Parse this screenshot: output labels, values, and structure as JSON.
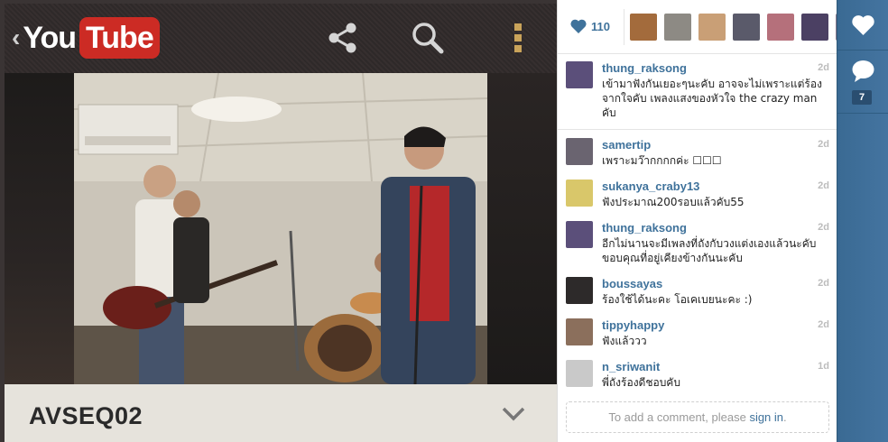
{
  "video_screen": {
    "logo": {
      "back_glyph": "‹",
      "you": "You",
      "tube": "Tube"
    },
    "icons": [
      "share-icon",
      "search-icon",
      "more-vertical-icon"
    ],
    "title": "AVSEQ02",
    "colors": {
      "logo_red": "#cc2b24",
      "title_bar": "#e6e3dc"
    }
  },
  "likes": {
    "count": "110",
    "likers": [
      {
        "color": "#a36b3c"
      },
      {
        "color": "#8d8a84"
      },
      {
        "color": "#c99f76"
      },
      {
        "color": "#5a5a6a"
      },
      {
        "color": "#b5707b"
      },
      {
        "color": "#4b4063"
      },
      {
        "color": "#8b7d91"
      }
    ]
  },
  "caption": {
    "user": "thung_raksong",
    "time": "2d",
    "text": "เข้ามาฟังกันเยอะๆนะคับ อาจจะไม่เพราะแต่ร้องจากใจคับ เพลงแสงของหัวใจ the crazy man คับ",
    "avatar_color": "#5b4f7a"
  },
  "comments": [
    {
      "user": "samertip",
      "time": "2d",
      "text": "เพราะมว๊ากกกกค่ะ ☐☐☐",
      "avatar_color": "#6a6470"
    },
    {
      "user": "sukanya_craby13",
      "time": "2d",
      "text": "ฟังประมาณ200รอบแล้วคับ55",
      "avatar_color": "#d9c76a"
    },
    {
      "user": "thung_raksong",
      "time": "2d",
      "text": "อีกไม่นานจะมีเพลงที่ถังกับวงแต่งเองแล้วนะคับ ขอบคุณที่อยู่เคียงข้างกันนะคับ",
      "avatar_color": "#5b4f7a"
    },
    {
      "user": "boussayas",
      "time": "2d",
      "text": "ร้องใช้ได้นะคะ โอเคเบยนะคะ :)",
      "avatar_color": "#2d2a2a"
    },
    {
      "user": "tippyhappy",
      "time": "2d",
      "text": "ฟังแล้ววว",
      "avatar_color": "#8b6f5c"
    },
    {
      "user": "n_sriwanit",
      "time": "1d",
      "text": "พี่ถังร้องดีชอบคับ",
      "avatar_color": "#c9c9c9"
    }
  ],
  "comment_prompt": {
    "prefix": "To add a comment, please ",
    "link": "sign in",
    "suffix": "."
  },
  "rail": {
    "comment_count": "7",
    "icons": [
      "heart-icon",
      "speech-bubble-icon"
    ]
  },
  "colors": {
    "link_blue": "#3f729b",
    "rail_blue": "#4474a0"
  }
}
